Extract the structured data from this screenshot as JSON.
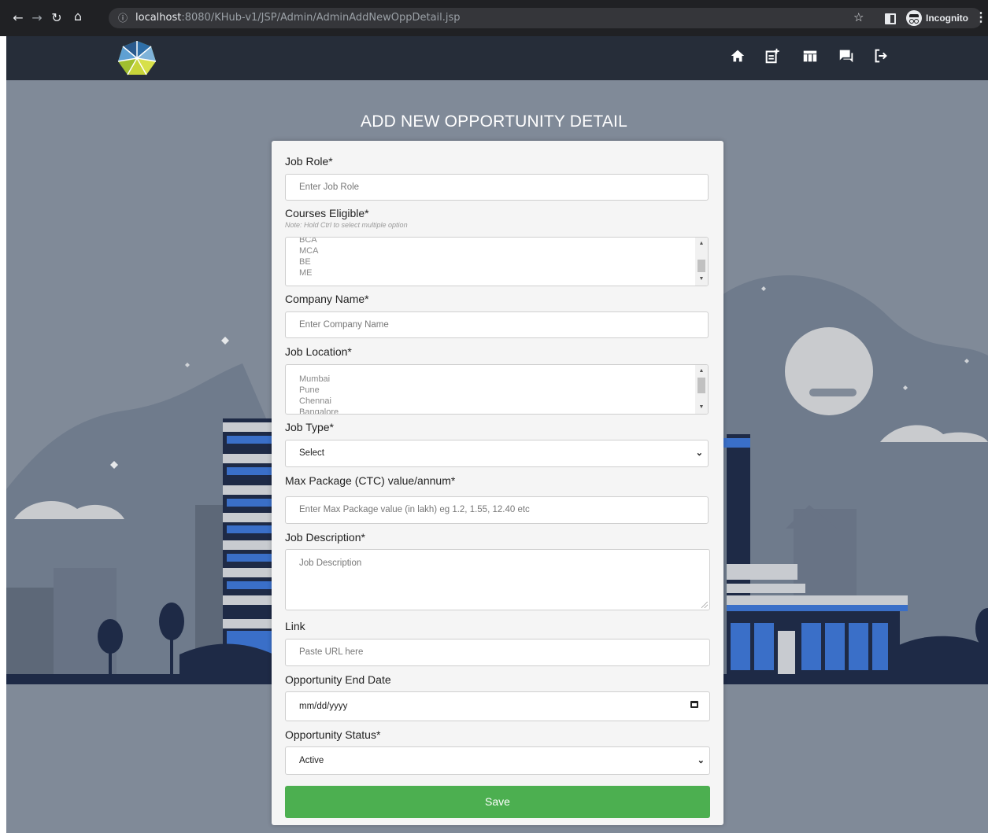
{
  "browser": {
    "url_host": "localhost",
    "url_path": ":8080/KHub-v1/JSP/Admin/AdminAddNewOppDetail.jsp",
    "incognito_label": "Incognito"
  },
  "page": {
    "heading": "ADD NEW OPPORTUNITY DETAIL"
  },
  "form": {
    "job_role": {
      "label": "Job Role*",
      "placeholder": "Enter Job Role"
    },
    "courses": {
      "label": "Courses Eligible*",
      "note": "Note: Hold Ctrl to select multiple option",
      "options": [
        "BCA",
        "MCA",
        "BE",
        "ME"
      ]
    },
    "company": {
      "label": "Company Name*",
      "placeholder": "Enter Company Name"
    },
    "location": {
      "label": "Job Location*",
      "options": [
        "Mumbai",
        "Pune",
        "Chennai",
        "Bangalore"
      ]
    },
    "job_type": {
      "label": "Job Type*",
      "value": "Select"
    },
    "package": {
      "label": "Max Package (CTC) value/annum*",
      "placeholder": "Enter Max Package value (in lakh) eg 1.2, 1.55, 12.40 etc"
    },
    "description": {
      "label": "Job Description*",
      "placeholder": "Job Description"
    },
    "link": {
      "label": "Link",
      "placeholder": "Paste URL here"
    },
    "end_date": {
      "label": "Opportunity End Date",
      "value": "mm/dd/yyyy"
    },
    "status": {
      "label": "Opportunity Status*",
      "value": "Active"
    },
    "save_label": "Save"
  },
  "colors": {
    "navbar": "#262d39",
    "background": "#808a98",
    "save_button": "#4caf50"
  }
}
